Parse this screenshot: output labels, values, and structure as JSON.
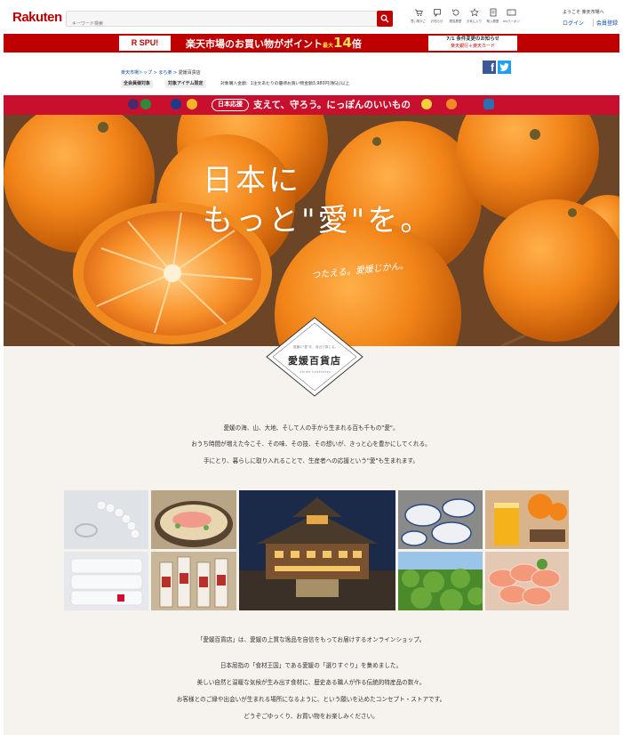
{
  "header": {
    "logo": "Rakuten",
    "search_placeholder": "キーワード検索",
    "nav": [
      {
        "icon": "cart-icon",
        "glyph": "🛒",
        "label": "買い物かご"
      },
      {
        "icon": "chat-icon",
        "glyph": "☐",
        "label": "お知らせ"
      },
      {
        "icon": "history-icon",
        "glyph": "⟲",
        "label": "閲覧履歴"
      },
      {
        "icon": "star-icon",
        "glyph": "☆",
        "label": "お気に入り"
      },
      {
        "icon": "receipt-icon",
        "glyph": "▤",
        "label": "購入履歴"
      },
      {
        "icon": "coupon-icon",
        "glyph": "▭",
        "label": "myクーポン"
      }
    ],
    "welcome": "ようこそ 楽天市場へ",
    "login": "ログイン",
    "register": "会員登録"
  },
  "spu_banner": {
    "logo": "R SPU!",
    "text_prefix": "楽天市場のお買い物がポイント",
    "text_small": "最大",
    "text_big": "14",
    "text_suffix": "倍",
    "notice_title": "7/1 条件変更のお知らせ",
    "notice_sub": "楽天銀行＋楽天カード"
  },
  "breadcrumb": {
    "home": "楽天市場トップ",
    "store": "まち楽",
    "current": "愛媛百貨店",
    "sep": " > "
  },
  "tags": {
    "all_members": "全会員様対象",
    "target_items": "対象アイテム限定",
    "note": "対象購入金額：1注文あたりの優待お買い物金額3,980円(税込)以上"
  },
  "social": {
    "facebook": "f"
  },
  "japan_strip": {
    "badge": "日本応援",
    "text": "支えて、守ろう。にっぽんのいいもの"
  },
  "hero": {
    "title": "日本に\nもっと\"愛\"を。",
    "subtitle": "つたえる。愛媛じかん。"
  },
  "emblem": {
    "small": "愛媛の\"愛\"を、身近で感じる。",
    "title": "愛媛百貨店",
    "roman": "ehime hyakkaten"
  },
  "intro": [
    "愛媛の海、山、大地、そして人の手から生まれる百も千もの\"愛\"。",
    "おうち時間が増えた今こそ、その味、その技、その想いが、きっと心を豊かにしてくれる。",
    "手にとり、暮らしに取り入れることで、生産者への応援という\"愛\"も生まれます。"
  ],
  "bottom_text": [
    "「愛媛百貨店」は、愛媛の上質な逸品を自信をもってお届けするオンラインショップ。",
    "日本屈指の「食材王国」である愛媛の「選りすぐり」を集めました。",
    "美しい自然と温暖な気候が生み出す食材に、歴史ある職人が作る伝統的特産品の数々。",
    "お客様とのご縁や出会いが生まれる場所になるように、という願いを込めたコンセプト・ストアです。",
    "どうぞごゆっくり、お買い物をお楽しみください。"
  ],
  "colors": {
    "brand": "#bf0000",
    "japan": "#c8102e",
    "link": "#0a4aa8"
  }
}
